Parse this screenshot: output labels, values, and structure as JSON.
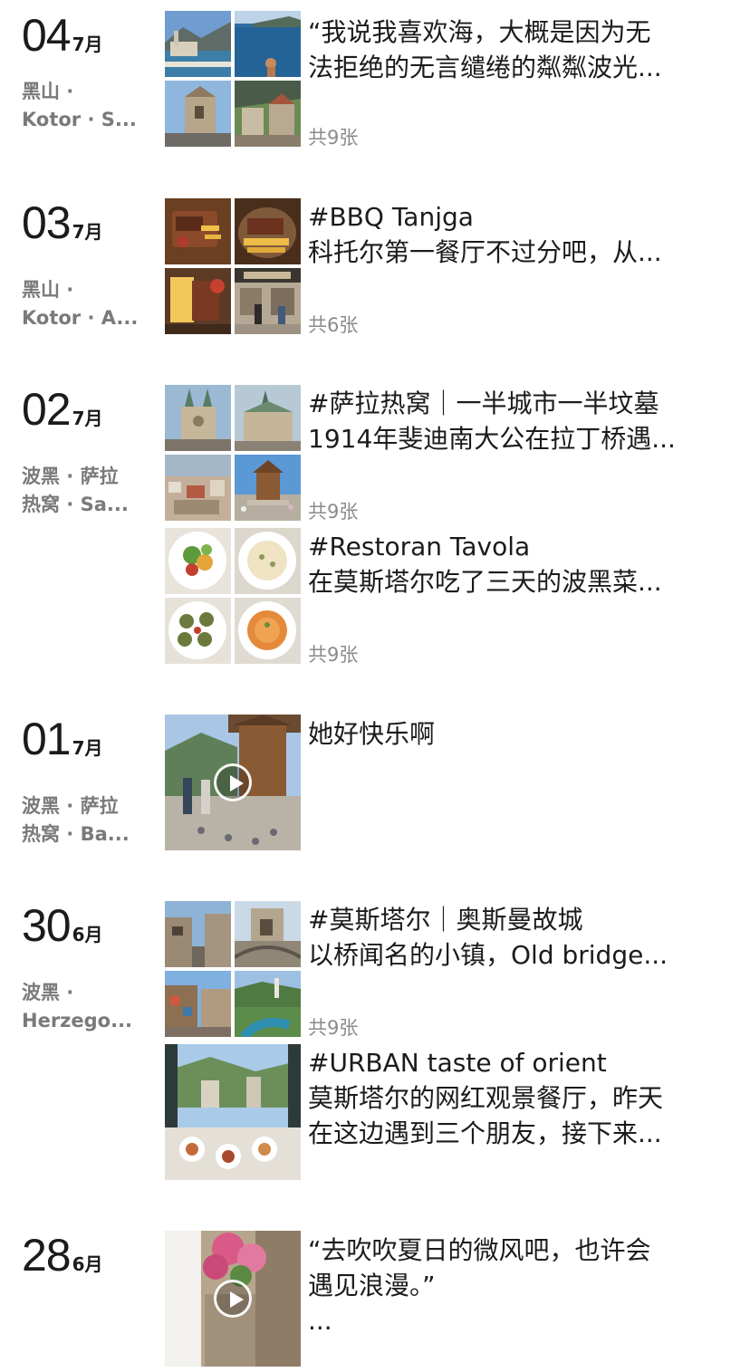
{
  "days": [
    {
      "day": "04",
      "month": "7月",
      "location": [
        "黑山 ·",
        "Kotor · S..."
      ],
      "posts": [
        {
          "lines": [
            "“我说我喜欢海，大概是因为无",
            "法拒绝的无言缱绻的粼粼波光..."
          ],
          "count": "共9张",
          "photos": [
            "montenegro-bay-town-photo",
            "montenegro-sea-swimmer-photo",
            "kotor-church-tower-photo",
            "kotor-old-town-photo"
          ]
        }
      ]
    },
    {
      "day": "03",
      "month": "7月",
      "location": [
        "黑山 ·",
        "Kotor · A..."
      ],
      "posts": [
        {
          "lines": [
            "#BBQ Tanjga",
            "科托尔第一餐厅不过分吧，从..."
          ],
          "count": "共6张",
          "photos": [
            "grilled-steak-fries-photo",
            "bbq-platter-photo",
            "steak-plate-photo",
            "bbq-restaurant-front-photo"
          ]
        }
      ]
    },
    {
      "day": "02",
      "month": "7月",
      "location": [
        "波黑 · 萨拉",
        "热窝 · Sa..."
      ],
      "posts": [
        {
          "lines": [
            "#萨拉热窝｜一半城市一半坟墓",
            "1914年斐迪南大公在拉丁桥遇..."
          ],
          "count": "共9张",
          "photos": [
            "sarajevo-cathedral-photo",
            "sarajevo-church-photo",
            "sarajevo-city-view-photo",
            "sebilj-fountain-photo"
          ]
        },
        {
          "lines": [
            "#Restoran Tavola",
            "在莫斯塔尔吃了三天的波黑菜..."
          ],
          "count": "共9张",
          "photos": [
            "salad-dish-photo",
            "risotto-dish-photo",
            "stuffed-mushroom-photo",
            "spaghetti-dish-photo"
          ]
        }
      ]
    },
    {
      "day": "01",
      "month": "7月",
      "location": [
        "波黑 · 萨拉",
        "热窝 · Ba..."
      ],
      "posts": [
        {
          "lines": [
            "她好快乐啊"
          ],
          "count": "",
          "video": "sebilj-pigeons-video"
        }
      ]
    },
    {
      "day": "30",
      "month": "6月",
      "location": [
        "波黑 ·",
        "Herzego..."
      ],
      "posts": [
        {
          "lines": [
            "#莫斯塔尔｜奥斯曼故城",
            "以桥闻名的小镇，Old bridge..."
          ],
          "count": "共9张",
          "photos": [
            "mostar-street-photo",
            "mostar-old-bridge-photo",
            "mostar-bazaar-photo",
            "mostar-river-photo"
          ]
        },
        {
          "lines": [
            "#URBAN taste of orient",
            "莫斯塔尔的网红观景餐厅，昨天",
            "在这边遇到三个朋友，接下来..."
          ],
          "count": "",
          "single": "restaurant-terrace-view-photo"
        }
      ]
    },
    {
      "day": "28",
      "month": "6月",
      "location": [],
      "posts": [
        {
          "lines": [
            "“去吹吹夏日的微风吧，也许会",
            "遇见浪漫。”",
            "..."
          ],
          "count": "",
          "video": "flower-alley-video"
        }
      ]
    }
  ],
  "colors": {
    "text": "#1b1b1b",
    "muted": "#7a7a7a",
    "count": "#8b8b8b",
    "background": "#ffffff"
  }
}
